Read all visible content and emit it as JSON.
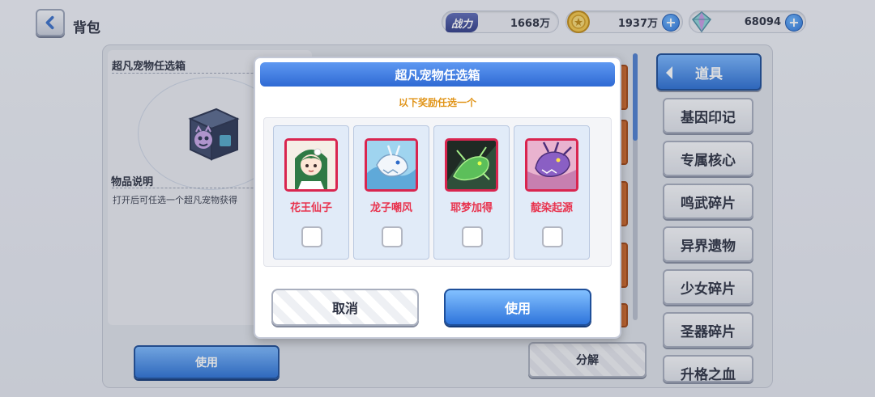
{
  "header": {
    "title": "背包",
    "power_label": "战力",
    "power_value": "1668万",
    "gold_value": "1937万",
    "gem_value": "68094",
    "plus_symbol": "+"
  },
  "detail": {
    "item_title": "超凡宠物任选箱",
    "desc_title": "物品说明",
    "desc_text": "打开后可任选一个超凡宠物获得",
    "use_label": "使用",
    "decompose_label": "分解"
  },
  "categories": [
    {
      "label": "道具",
      "active": true
    },
    {
      "label": "基因印记"
    },
    {
      "label": "专属核心"
    },
    {
      "label": "鸣武碎片"
    },
    {
      "label": "异界遗物"
    },
    {
      "label": "少女碎片"
    },
    {
      "label": "圣器碎片"
    },
    {
      "label": "升格之血"
    }
  ],
  "modal": {
    "title": "超凡宠物任选箱",
    "subtitle": "以下奖励任选一个",
    "choices": [
      {
        "name": "花王仙子",
        "icon": "flower-fairy-portrait-icon",
        "checked": false
      },
      {
        "name": "龙子嘲风",
        "icon": "white-dragon-portrait-icon",
        "checked": false
      },
      {
        "name": "耶梦加得",
        "icon": "green-serpent-portrait-icon",
        "checked": false
      },
      {
        "name": "靛染起源",
        "icon": "purple-dragon-portrait-icon",
        "checked": false
      }
    ],
    "cancel_label": "取消",
    "confirm_label": "使用"
  },
  "colors": {
    "accent_blue": "#2f6ad4",
    "name_red": "#e8344f",
    "subtitle_orange": "#e1951a",
    "portrait_border": "#d9254f"
  }
}
